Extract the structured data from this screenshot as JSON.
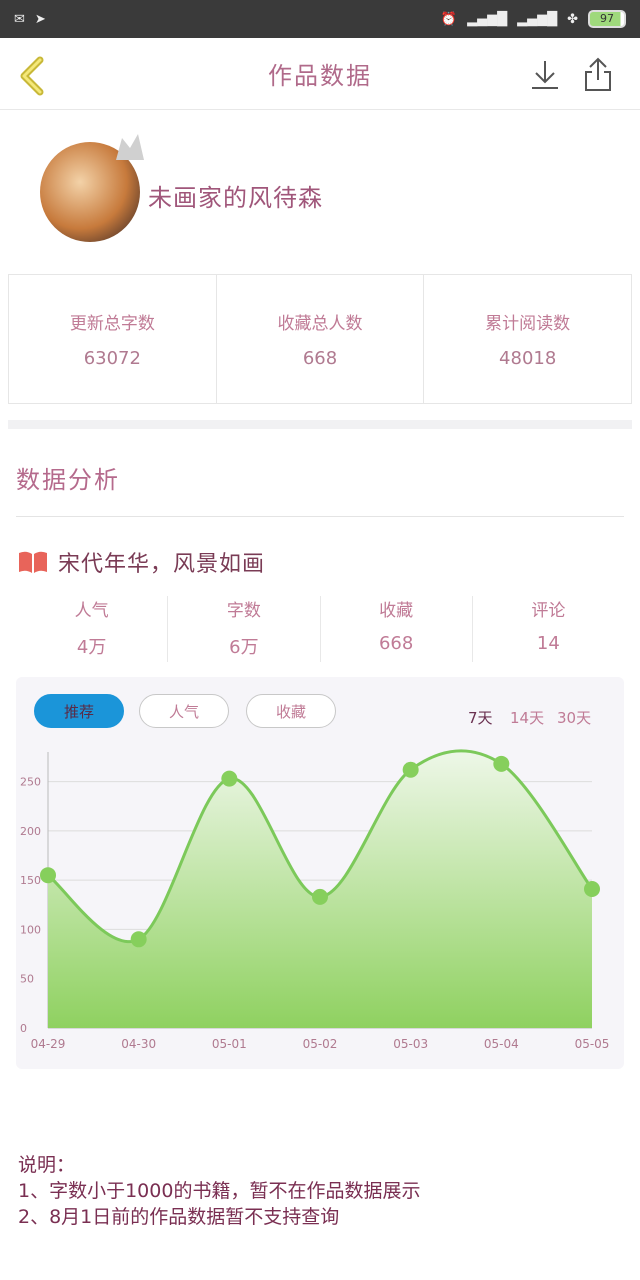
{
  "header": {
    "title": "作品数据"
  },
  "profile": {
    "username": "未画家的风待森"
  },
  "stats": [
    {
      "label": "更新总字数",
      "value": "63072"
    },
    {
      "label": "收藏总人数",
      "value": "668"
    },
    {
      "label": "累计阅读数",
      "value": "48018"
    }
  ],
  "section": {
    "title": "数据分析"
  },
  "book": {
    "title": "宋代年华，风景如画"
  },
  "metrics": [
    {
      "label": "人气",
      "value": "4万"
    },
    {
      "label": "字数",
      "value": "6万"
    },
    {
      "label": "收藏",
      "value": "668"
    },
    {
      "label": "评论",
      "value": "14"
    }
  ],
  "chart_tabs": {
    "recommend": "推荐",
    "popularity": "人气",
    "favorites": "收藏"
  },
  "ranges": {
    "d7": "7天",
    "d14": "14天",
    "d30": "30天"
  },
  "colors": {
    "accent": "#1b95d9",
    "line": "#7cc95a",
    "fill_top": "#e8f5e0",
    "fill_bottom": "#8fd160"
  },
  "chart_data": {
    "type": "area",
    "categories": [
      "04-29",
      "04-30",
      "05-01",
      "05-02",
      "05-03",
      "05-04",
      "05-05"
    ],
    "series": [
      {
        "values": [
          155,
          90,
          253,
          133,
          262,
          268,
          141
        ]
      }
    ],
    "yticks": [
      "0",
      "50",
      "100",
      "150",
      "200",
      "250"
    ],
    "ylim": [
      0,
      280
    ]
  },
  "notes": {
    "heading": "说明：",
    "line1": "1、字数小于1000的书籍，暂不在作品数据展示",
    "line2": "2、8月1日前的作品数据暂不支持查询"
  }
}
